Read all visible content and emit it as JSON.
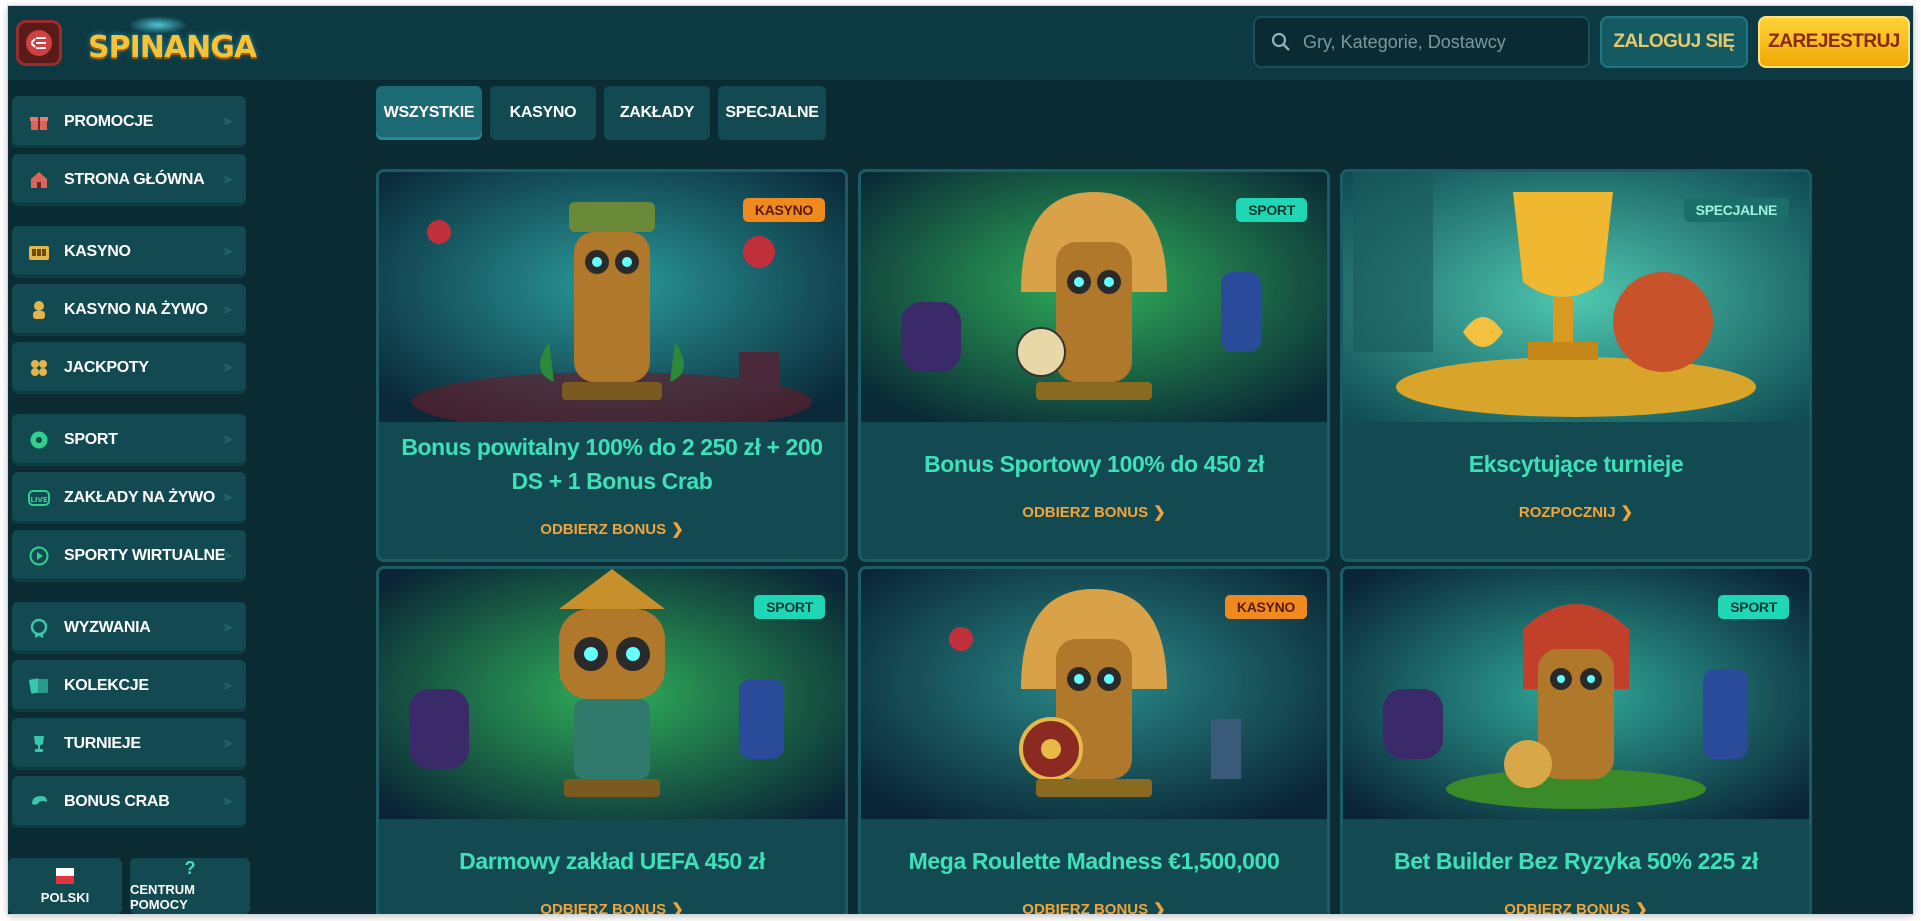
{
  "app": {
    "brand": "SPINANGA",
    "accent": "#3fe0b8",
    "cta_color": "#f2a43a"
  },
  "header": {
    "search_placeholder": "Gry, Kategorie, Dostawcy",
    "login_label": "ZALOGUJ SIĘ",
    "register_label": "ZAREJESTRUJ"
  },
  "sidebar": {
    "items": [
      {
        "label": "PROMOCJE",
        "icon": "gift-icon"
      },
      {
        "label": "STRONA GŁÓWNA",
        "icon": "home-icon"
      },
      {
        "label": "KASYNO",
        "icon": "casino-icon"
      },
      {
        "label": "KASYNO NA ŻYWO",
        "icon": "dealer-icon"
      },
      {
        "label": "JACKPOTY",
        "icon": "clover-icon"
      },
      {
        "label": "SPORT",
        "icon": "soccer-ball-icon"
      },
      {
        "label": "ZAKŁADY NA ŻYWO",
        "icon": "live-icon"
      },
      {
        "label": "SPORTY WIRTUALNE",
        "icon": "play-icon"
      },
      {
        "label": "WYZWANIA",
        "icon": "badge-icon"
      },
      {
        "label": "KOLEKCJE",
        "icon": "cards-icon"
      },
      {
        "label": "TURNIEJE",
        "icon": "trophy-icon"
      },
      {
        "label": "BONUS CRAB",
        "icon": "crab-icon"
      }
    ],
    "footer": {
      "language_label": "POLSKI",
      "help_label": "CENTRUM POMOCY"
    }
  },
  "tabs": [
    {
      "label": "WSZYSTKIE",
      "active": true
    },
    {
      "label": "KASYNO",
      "active": false
    },
    {
      "label": "ZAKŁADY",
      "active": false
    },
    {
      "label": "SPECJALNE",
      "active": false
    }
  ],
  "promotions": [
    {
      "badge": "KASYNO",
      "title": "Bonus powitalny 100% do 2 250 zł + 200 DS + 1 Bonus Crab",
      "cta": "ODBIERZ BONUS"
    },
    {
      "badge": "SPORT",
      "title": "Bonus Sportowy 100% do 450 zł",
      "cta": "ODBIERZ BONUS"
    },
    {
      "badge": "SPECJALNE",
      "title": "Ekscytujące turnieje",
      "cta": "ROZPOCZNIJ"
    },
    {
      "badge": "SPORT",
      "title": "Darmowy zakład UEFA 450 zł",
      "cta": "ODBIERZ BONUS"
    },
    {
      "badge": "KASYNO",
      "title": "Mega Roulette Madness €1,500,000",
      "cta": "ODBIERZ BONUS"
    },
    {
      "badge": "SPORT",
      "title": "Bet Builder Bez Ryzyka 50% 225 zł",
      "cta": "ODBIERZ BONUS"
    }
  ]
}
